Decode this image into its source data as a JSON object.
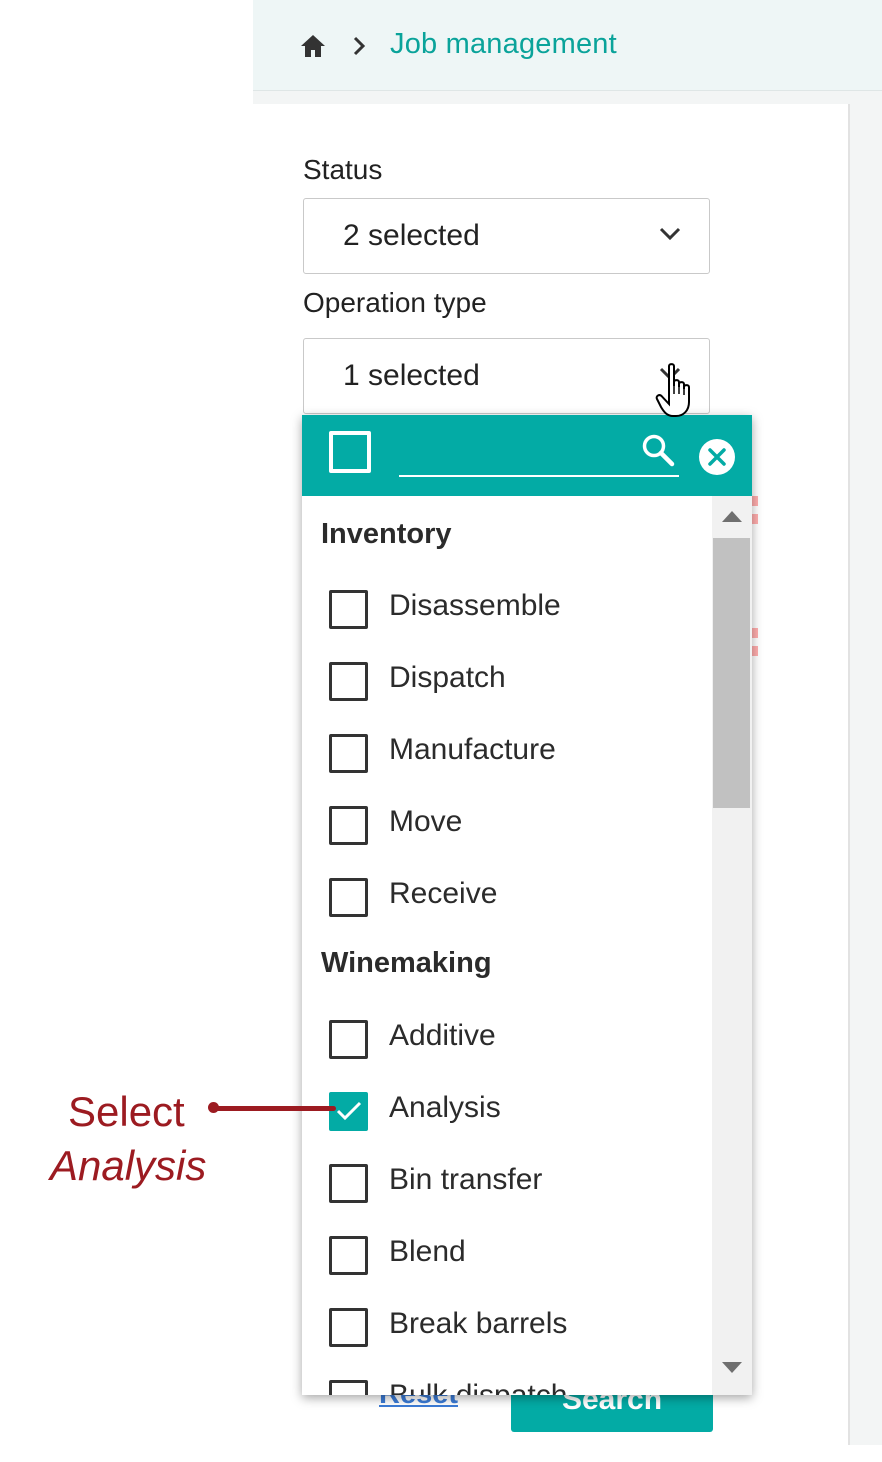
{
  "breadcrumb": {
    "title": "Job management"
  },
  "filters": {
    "status": {
      "label": "Status",
      "value": "2 selected"
    },
    "operation_type": {
      "label": "Operation type",
      "value": "1 selected"
    }
  },
  "dropdown": {
    "search_placeholder": "",
    "groups": [
      {
        "name": "Inventory",
        "options": [
          {
            "label": "Disassemble",
            "checked": false
          },
          {
            "label": "Dispatch",
            "checked": false
          },
          {
            "label": "Manufacture",
            "checked": false
          },
          {
            "label": "Move",
            "checked": false
          },
          {
            "label": "Receive",
            "checked": false
          }
        ]
      },
      {
        "name": "Winemaking",
        "options": [
          {
            "label": "Additive",
            "checked": false
          },
          {
            "label": "Analysis",
            "checked": true
          },
          {
            "label": "Bin transfer",
            "checked": false
          },
          {
            "label": "Blend",
            "checked": false
          },
          {
            "label": "Break barrels",
            "checked": false
          },
          {
            "label": "Bulk dispatch",
            "checked": false
          }
        ]
      }
    ]
  },
  "actions": {
    "reset_label": "Reset",
    "search_label": "Search"
  },
  "callout": {
    "line1": "Select",
    "line2": "Analysis"
  },
  "colors": {
    "accent": "#03aba5",
    "callout": "#9c1b21",
    "link": "#3b7bd6"
  }
}
